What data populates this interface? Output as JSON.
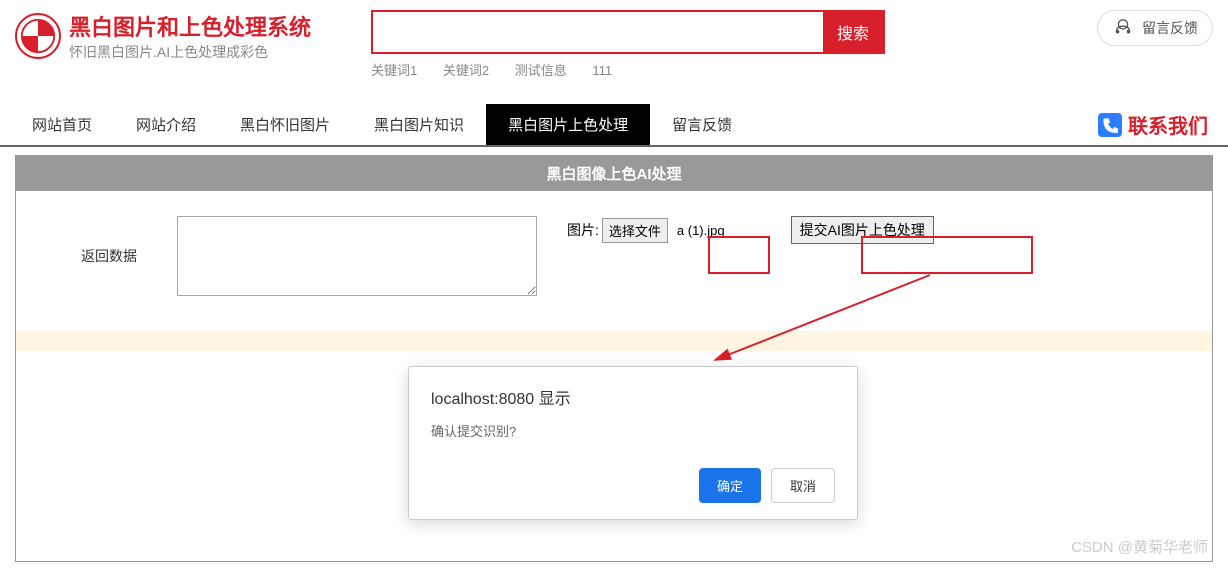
{
  "header": {
    "title": "黑白图片和上色处理系统",
    "subtitle": "怀旧黑白图片.AI上色处理成彩色",
    "search_btn": "搜索",
    "keywords": [
      "关键词1",
      "关键词2",
      "测试信息",
      "111"
    ],
    "feedback": "留言反馈"
  },
  "nav": {
    "items": [
      "网站首页",
      "网站介绍",
      "黑白怀旧图片",
      "黑白图片知识",
      "黑白图片上色处理",
      "留言反馈"
    ],
    "active_index": 4,
    "contact": "联系我们"
  },
  "main": {
    "section_title": "黑白图像上色AI处理",
    "return_label": "返回数据",
    "file_label": "图片:",
    "file_btn": "选择文件",
    "file_name": "a (1).jpg",
    "submit_btn": "提交AI图片上色处理"
  },
  "dialog": {
    "title": "localhost:8080 显示",
    "message": "确认提交识别?",
    "ok": "确定",
    "cancel": "取消"
  },
  "watermark": "CSDN @黄菊华老师"
}
